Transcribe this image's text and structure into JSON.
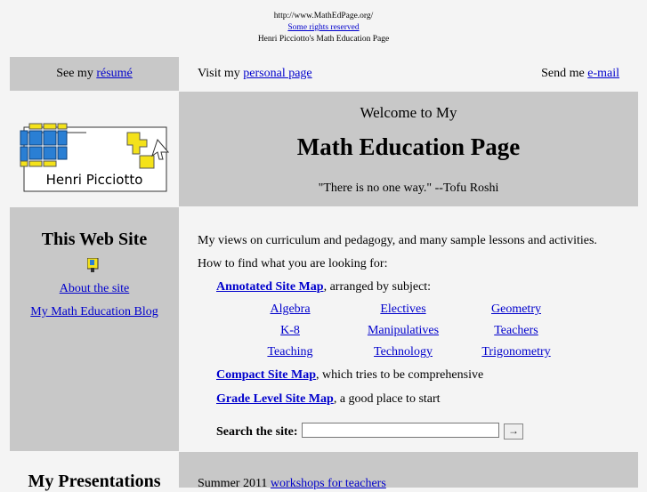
{
  "header": {
    "url": "http://www.MathEdPage.org/",
    "rights_link": "Some rights reserved",
    "site_owner_title": "Henri Picciotto's Math Education Page"
  },
  "nav": {
    "left_prefix": "See my ",
    "left_link": "résumé",
    "mid_prefix": "Visit my ",
    "mid_link": "personal page",
    "right_prefix": "Send me ",
    "right_link": "e-mail"
  },
  "logo": {
    "name": "Henri Picciotto"
  },
  "welcome": {
    "line1": "Welcome to My",
    "line2": "Math Education Page",
    "quote": "\"There is no one way.\" --Tofu Roshi"
  },
  "sidebar": {
    "title": "This Web Site",
    "links": [
      "About the site",
      "My Math Education Blog"
    ]
  },
  "main": {
    "intro": "My views on curriculum and pedagogy, and many sample lessons and activities.",
    "howto": "How to find what you are looking for:",
    "annotated_link": "Annotated Site Map",
    "annotated_suffix": ", arranged by subject:",
    "subjects": [
      [
        "Algebra",
        "Electives",
        "Geometry"
      ],
      [
        "K-8",
        "Manipulatives",
        "Teachers"
      ],
      [
        "Teaching",
        "Technology",
        "Trigonometry"
      ]
    ],
    "compact_link": "Compact Site Map",
    "compact_suffix": ", which tries to be comprehensive",
    "grade_link": "Grade Level Site Map",
    "grade_suffix": ", a good place to start",
    "search_label": "Search the site:",
    "search_value": "",
    "search_button": "→"
  },
  "bottom": {
    "left_title": "My Presentations",
    "right_prefix": "Summer 2011 ",
    "right_link": "workshops for teachers"
  },
  "colors": {
    "link": "#0000cc",
    "panel": "#c8c8c8",
    "background": "#f4f4f4"
  }
}
